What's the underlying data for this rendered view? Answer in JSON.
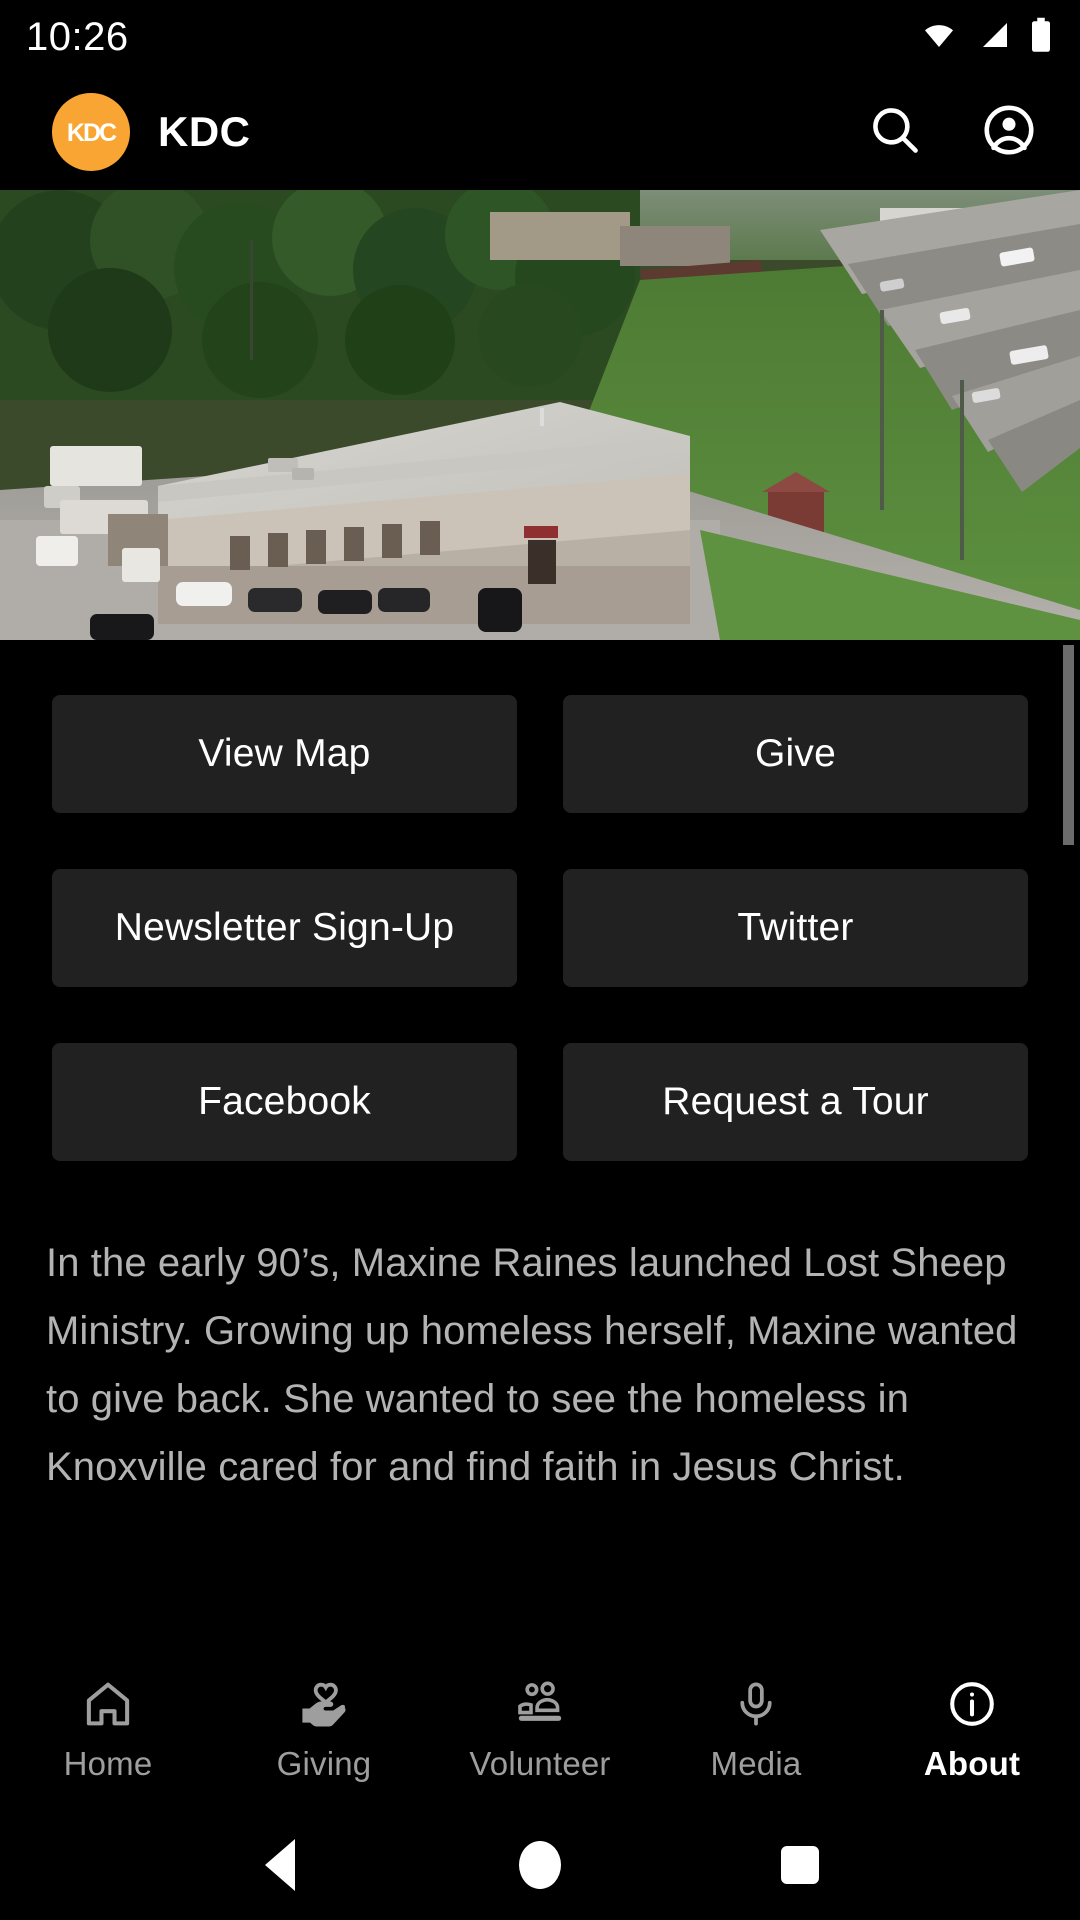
{
  "status_bar": {
    "time": "10:26",
    "icons": [
      "wifi-icon",
      "cellular-signal-icon",
      "battery-icon"
    ]
  },
  "header": {
    "logo_text": "KDC",
    "title": "KDC",
    "logo_color": "#F9A533",
    "actions": [
      {
        "name": "search-icon",
        "label": "Search"
      },
      {
        "name": "account-circle-icon",
        "label": "Account"
      }
    ]
  },
  "hero": {
    "alt": "Aerial drone photo of a large warehouse building with parking lot, trees and an interstate highway"
  },
  "tiles": [
    {
      "label": "View Map",
      "name": "view-map-button"
    },
    {
      "label": "Give",
      "name": "give-button"
    },
    {
      "label": "Newsletter Sign-Up",
      "name": "newsletter-signup-button"
    },
    {
      "label": "Twitter",
      "name": "twitter-button"
    },
    {
      "label": "Facebook",
      "name": "facebook-button"
    },
    {
      "label": "Request a Tour",
      "name": "request-a-tour-button"
    }
  ],
  "about": {
    "paragraph": "In the early 90’s, Maxine Raines launched Lost Sheep Ministry.  Growing up homeless herself, Maxine wanted to give back.  She wanted to see the homeless in Knoxville cared for and find faith in Jesus Christ."
  },
  "tabs": [
    {
      "label": "Home",
      "icon": "home-icon",
      "active": false
    },
    {
      "label": "Giving",
      "icon": "hand-heart-icon",
      "active": false
    },
    {
      "label": "Volunteer",
      "icon": "people-icon",
      "active": false
    },
    {
      "label": "Media",
      "icon": "microphone-icon",
      "active": false
    },
    {
      "label": "About",
      "icon": "info-circle-icon",
      "active": true
    }
  ],
  "system_nav": {
    "back": "back-button",
    "home": "home-button",
    "recents": "recents-button"
  },
  "colors": {
    "background": "#000000",
    "tile": "#212121",
    "body_text": "#b3b3b3",
    "accent": "#F9A533",
    "inactive_tab": "#9e9e9e",
    "scrollbar": "#6b6b6b"
  }
}
